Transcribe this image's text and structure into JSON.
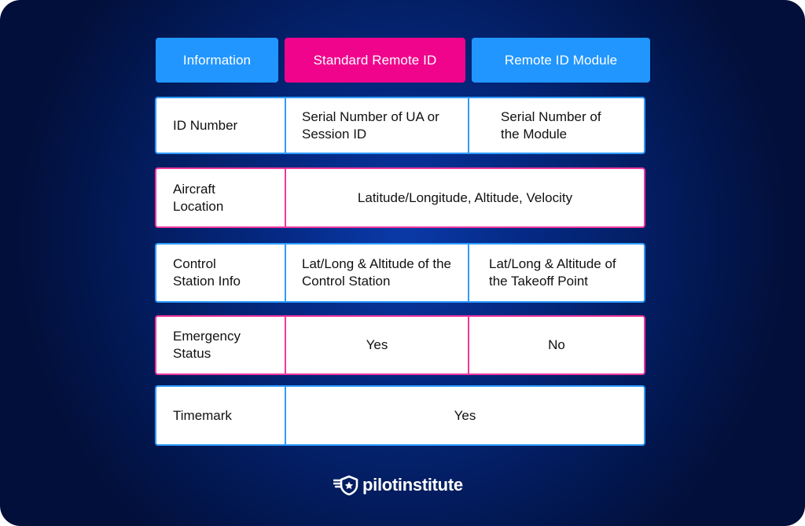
{
  "headers": {
    "information": "Information",
    "standard": "Standard Remote ID",
    "module": "Remote ID Module"
  },
  "rows": [
    {
      "label": "ID Number",
      "standard": "Serial Number of UA or Session ID",
      "module": "Serial Number of the Module",
      "style": "blue"
    },
    {
      "label": "Aircraft Location",
      "both": "Latitude/Longitude, Altitude, Velocity",
      "style": "pink"
    },
    {
      "label": "Control Station Info",
      "standard": "Lat/Long & Altitude of the Control Station",
      "module": "Lat/Long & Altitude of the Takeoff Point",
      "style": "blue"
    },
    {
      "label": "Emergency Status",
      "standard": "Yes",
      "module": "No",
      "style": "pink"
    },
    {
      "label": "Timemark",
      "both": "Yes",
      "style": "blue"
    }
  ],
  "brand": {
    "logo_text": "pilotinstitute",
    "logo_icon": "winged-shield-star-icon"
  },
  "colors": {
    "blue_accent": "#2196ff",
    "pink_accent": "#f0048c",
    "background_dark": "#020f3a"
  }
}
